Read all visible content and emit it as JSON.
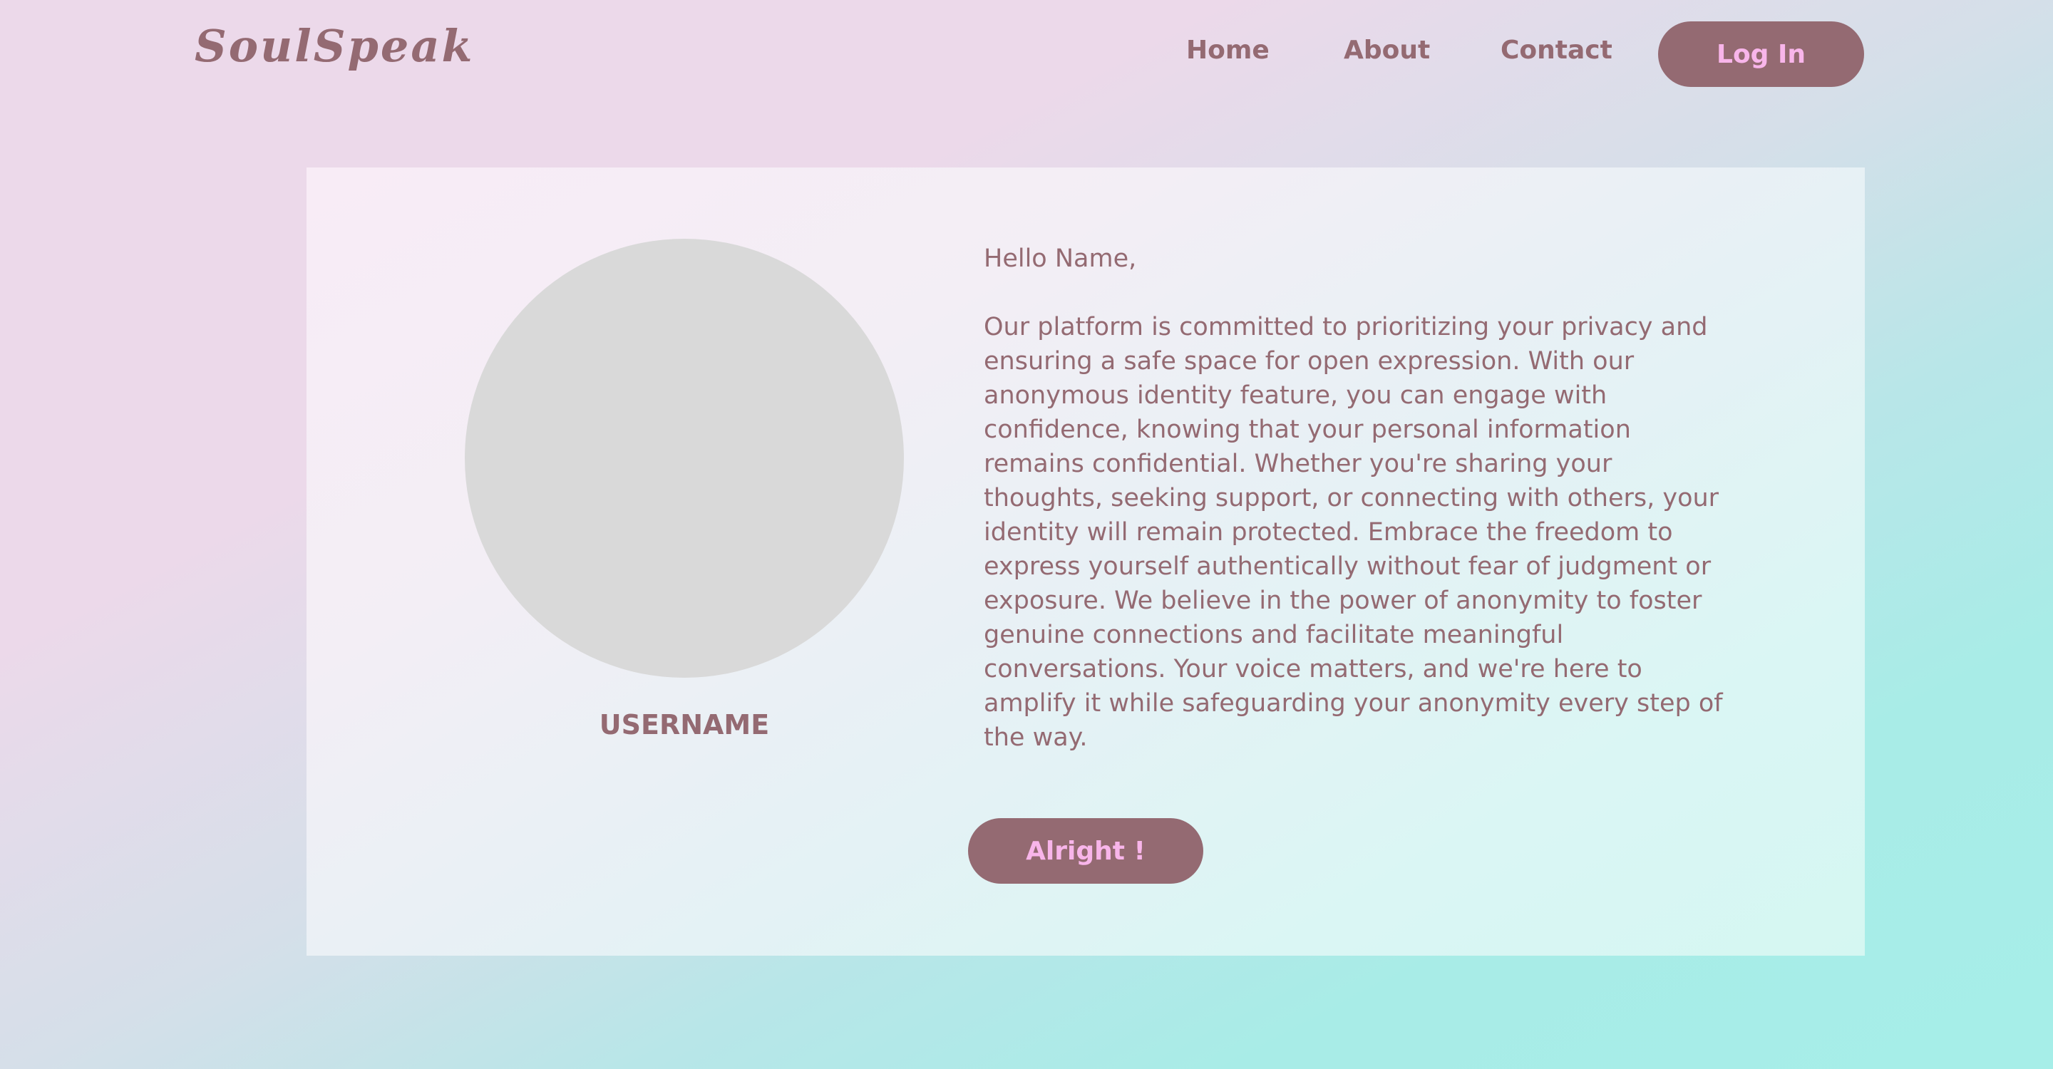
{
  "header": {
    "logo": "SoulSpeak",
    "nav": {
      "home": "Home",
      "about": "About",
      "contact": "Contact"
    },
    "login_label": "Log In"
  },
  "profile": {
    "username": "USERNAME"
  },
  "message": {
    "greeting": "Hello Name,",
    "body": "Our platform is committed to prioritizing your privacy and ensuring a safe space for open expression. With our anonymous identity feature, you can engage with confidence, knowing that your personal information remains confidential. Whether you're sharing your thoughts, seeking support, or connecting with others, your identity will remain protected. Embrace the freedom to express yourself authentically without fear of judgment or exposure. We believe in the power of anonymity to foster genuine connections and facilitate meaningful conversations. Your voice matters, and we're here to amplify it while safeguarding your anonymity every step of the way."
  },
  "actions": {
    "confirm_label": "Alright !"
  },
  "colors": {
    "accent": "#946a72",
    "button_text": "#f8b5ea",
    "avatar_placeholder": "#d9d9d9"
  }
}
